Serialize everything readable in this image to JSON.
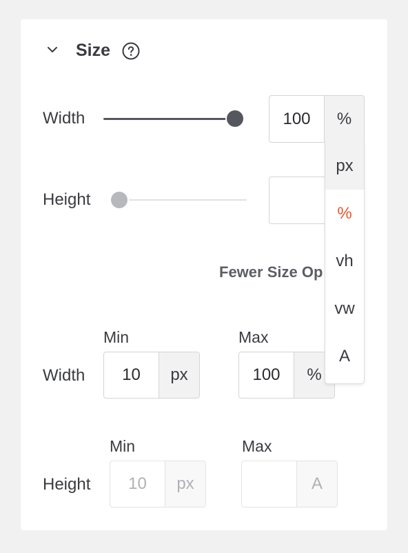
{
  "section": {
    "title": "Size",
    "help_icon": "question-circle-icon",
    "chevron_icon": "chevron-down-icon"
  },
  "width_row": {
    "label": "Width",
    "slider_value": 1.0,
    "value": "100",
    "unit": "%"
  },
  "height_row": {
    "label": "Height",
    "slider_value": 0.0,
    "value": "",
    "unit": ""
  },
  "unit_dropdown": {
    "options": [
      "px",
      "%",
      "vh",
      "vw",
      "A"
    ],
    "hovered": "px",
    "selected": "%",
    "selected_color": "#e8562a"
  },
  "fewer_options_link": "Fewer Size Options",
  "min_max": {
    "width": {
      "label": "Width",
      "min_label": "Min",
      "min_value": "10",
      "min_unit": "px",
      "max_label": "Max",
      "max_value": "100",
      "max_unit": "%"
    },
    "height": {
      "label": "Height",
      "min_label": "Min",
      "min_value": "10",
      "min_unit": "px",
      "max_label": "Max",
      "max_value": "",
      "max_unit": "A"
    }
  }
}
